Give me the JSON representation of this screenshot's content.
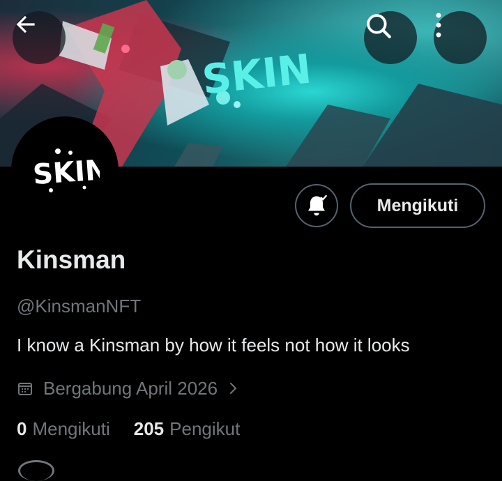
{
  "header": {
    "back_icon": "arrow-left-icon",
    "search_icon": "search-icon",
    "more_icon": "more-vertical-icon"
  },
  "banner": {
    "logo_text": "SKIN",
    "colors": {
      "teal": "#2bd6d2",
      "dark": "#0f2a35",
      "pink": "#b8324f"
    }
  },
  "avatar": {
    "logo_text": "SKIN"
  },
  "actions": {
    "notify_icon": "bell-check-icon",
    "follow_label": "Mengikuti"
  },
  "profile": {
    "name": "Kinsman",
    "handle": "@KinsmanNFT",
    "bio": "I know a Kinsman by how it feels not how it looks",
    "joined": "Bergabung April 2026",
    "joined_icon": "calendar-icon"
  },
  "stats": {
    "following_count": "0",
    "following_label": "Mengikuti",
    "followers_count": "205",
    "followers_label": "Pengikut"
  },
  "theme": {
    "text": "#e7e9ea",
    "muted": "#71767b",
    "border": "#536471",
    "bg": "#000000"
  }
}
